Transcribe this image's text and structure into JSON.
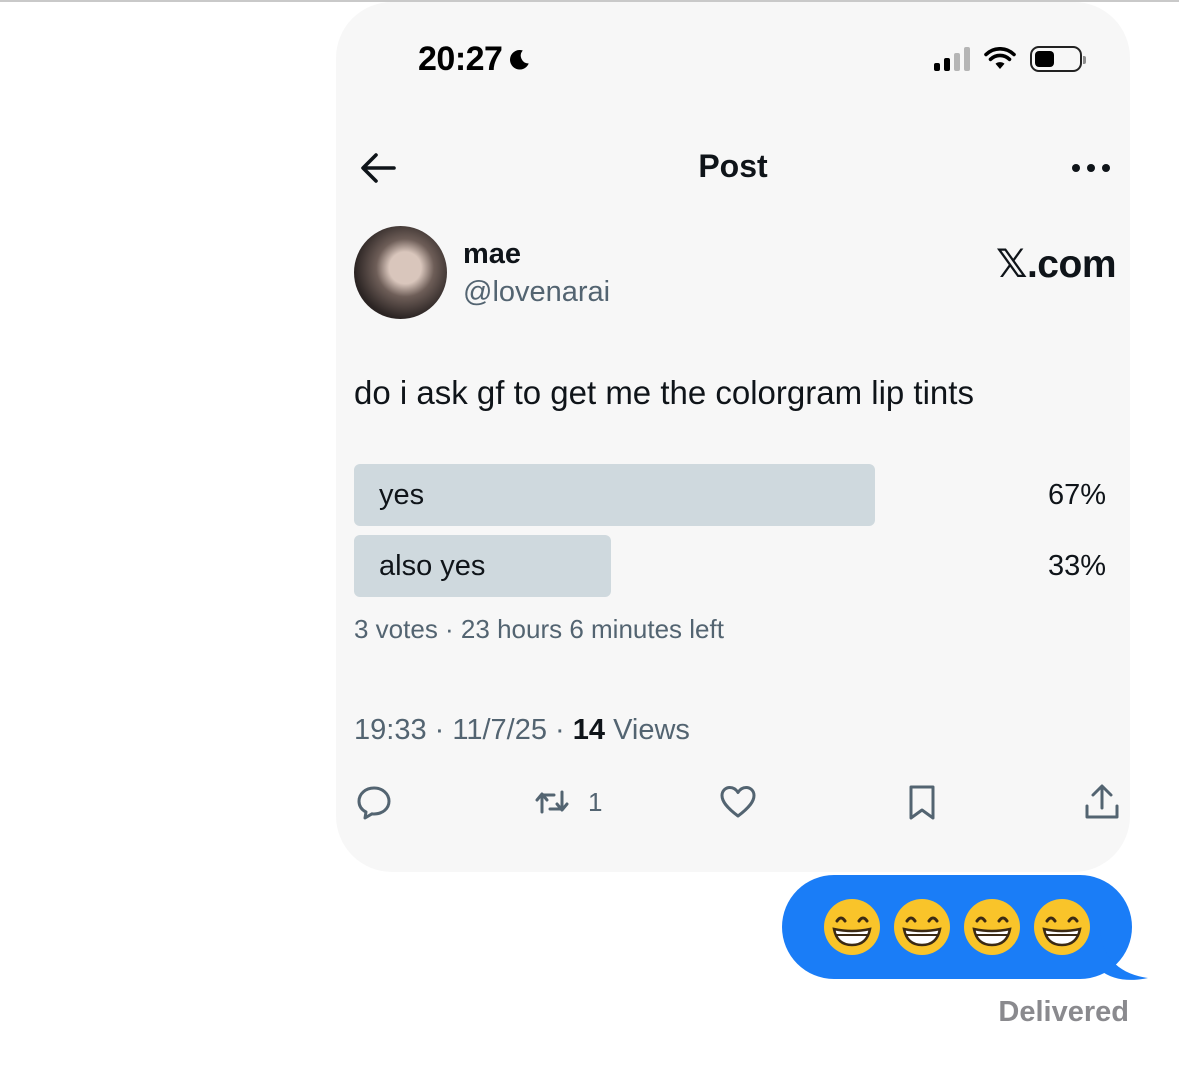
{
  "status_bar": {
    "time": "20:27"
  },
  "nav": {
    "title": "Post"
  },
  "author": {
    "name": "mae",
    "handle": "@lovenarai"
  },
  "brand": "𝕏.com",
  "post": {
    "text": "do i ask gf to get me the colorgram lip tints"
  },
  "poll": {
    "options": [
      {
        "label": "yes",
        "percent_text": "67%",
        "percent": 67
      },
      {
        "label": "also yes",
        "percent_text": "33%",
        "percent": 33
      }
    ],
    "meta": "3 votes · 23 hours 6 minutes left"
  },
  "post_meta": {
    "time": "19:33",
    "date": "11/7/25",
    "views_count": "14",
    "views_label": "Views"
  },
  "actions": {
    "retweet_count": "1"
  },
  "message": {
    "status": "Delivered"
  },
  "colors": {
    "imessage_blue": "#1a7df7",
    "poll_bar": "#cfd9de",
    "secondary_text": "#536471"
  }
}
